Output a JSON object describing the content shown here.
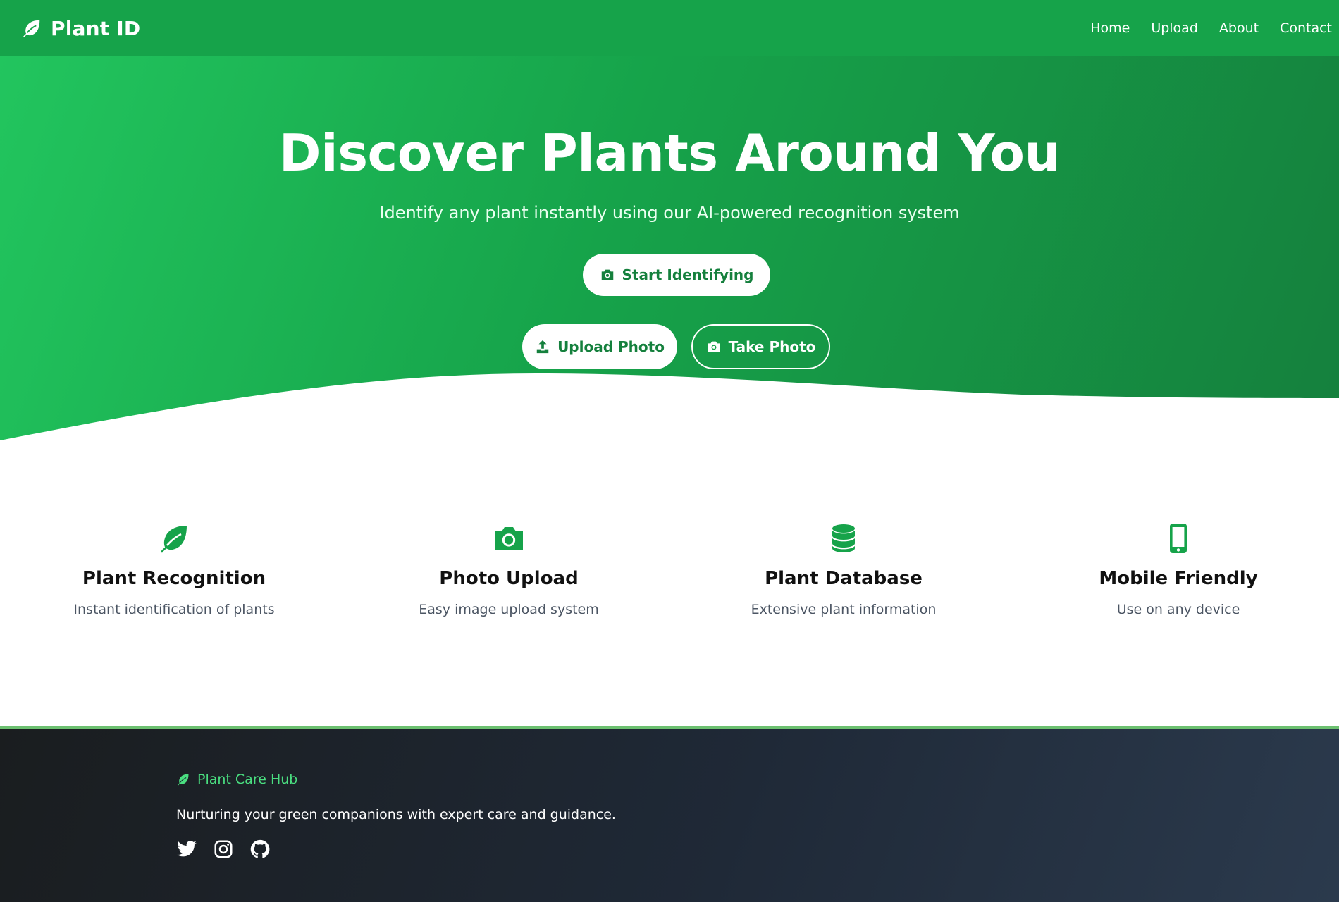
{
  "nav": {
    "brand": "Plant ID",
    "brand_icon": "leaf-icon",
    "links": [
      "Home",
      "Upload",
      "About",
      "Contact"
    ]
  },
  "hero": {
    "title": "Discover Plants Around You",
    "subtitle": "Identify any plant instantly using our AI-powered recognition system",
    "start_button": "Start Identifying",
    "upload_button": "Upload Photo",
    "take_button": "Take Photo"
  },
  "features": [
    {
      "icon": "leaf-icon",
      "title": "Plant Recognition",
      "desc": "Instant identification of plants"
    },
    {
      "icon": "camera-icon",
      "title": "Photo Upload",
      "desc": "Easy image upload system"
    },
    {
      "icon": "database-icon",
      "title": "Plant Database",
      "desc": "Extensive plant information"
    },
    {
      "icon": "mobile-icon",
      "title": "Mobile Friendly",
      "desc": "Use on any device"
    }
  ],
  "footer": {
    "brand": "Plant Care Hub",
    "tagline": "Nurturing your green companions with expert care and guidance.",
    "socials": [
      "twitter-icon",
      "instagram-icon",
      "github-icon"
    ]
  },
  "colors": {
    "primary_green": "#16a34a",
    "dark_green": "#15803d",
    "accent_green": "#4ade80",
    "footer_dark": "#1f2937"
  }
}
